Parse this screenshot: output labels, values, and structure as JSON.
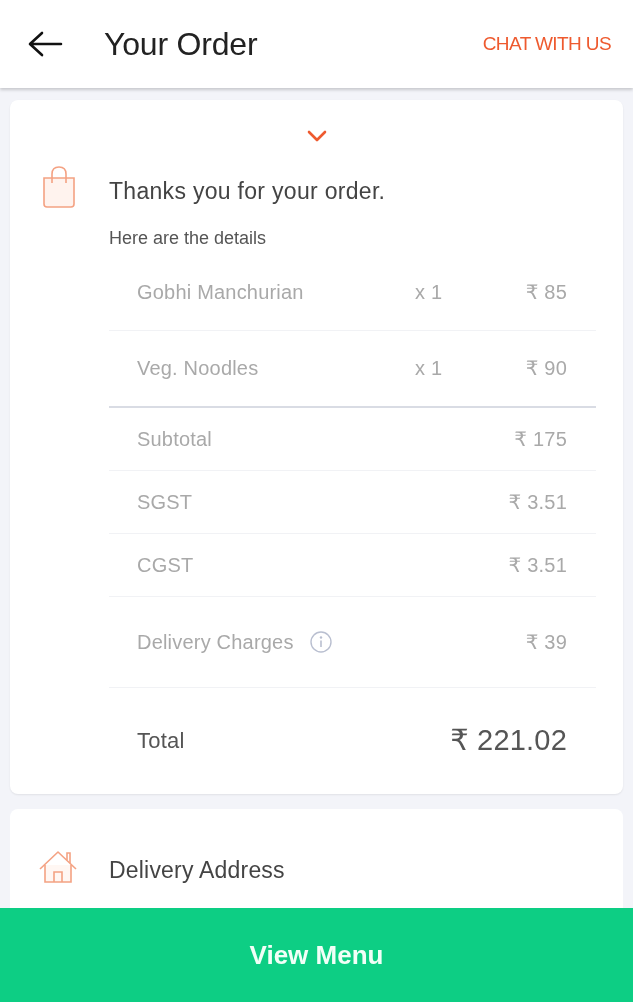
{
  "header": {
    "title": "Your Order",
    "action": "CHAT WITH US"
  },
  "order_card": {
    "title": "Thanks you for your order.",
    "subtitle": "Here are the details",
    "items": [
      {
        "name": "Gobhi Manchurian",
        "quantity": "x 1",
        "price": "₹ 85"
      },
      {
        "name": "Veg. Noodles",
        "quantity": "x 1",
        "price": "₹ 90"
      }
    ],
    "charges": [
      {
        "label": "Subtotal",
        "amount": "₹ 175",
        "info": false
      },
      {
        "label": "SGST",
        "amount": "₹ 3.51",
        "info": false
      },
      {
        "label": "CGST",
        "amount": "₹ 3.51",
        "info": false
      },
      {
        "label": "Delivery Charges",
        "amount": "₹ 39",
        "info": true
      }
    ],
    "total": {
      "label": "Total",
      "amount": "₹ 221.02"
    }
  },
  "address_card": {
    "title": "Delivery Address"
  },
  "bottom_button": {
    "label": "View Menu"
  }
}
